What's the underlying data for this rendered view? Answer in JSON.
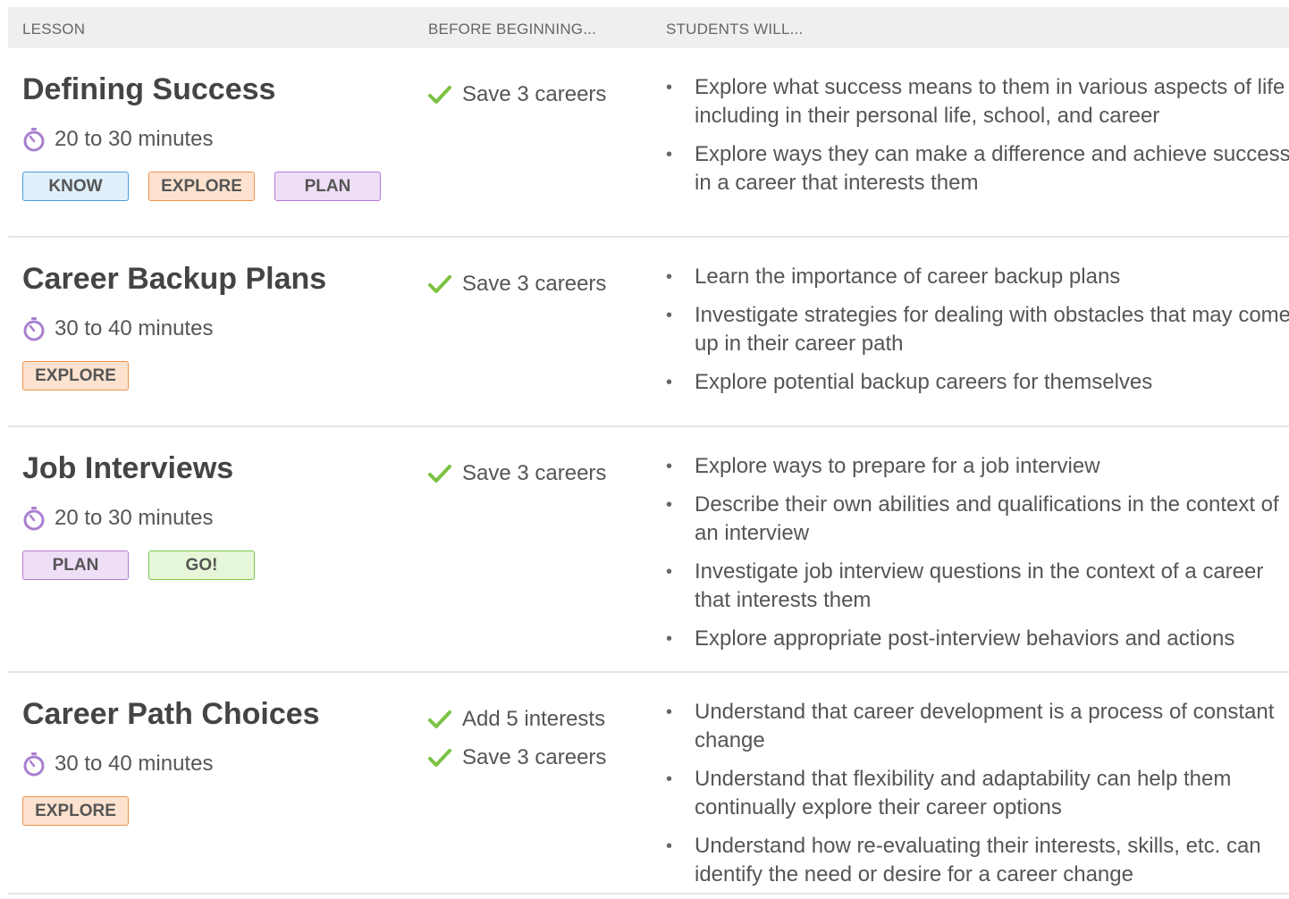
{
  "header": {
    "lesson": "LESSON",
    "before": "BEFORE BEGINNING...",
    "students": "STUDENTS WILL..."
  },
  "lessons": [
    {
      "title": "Defining Success",
      "duration": "20 to 30 minutes",
      "tags": [
        "KNOW",
        "EXPLORE",
        "PLAN"
      ],
      "prereqs": [
        "Save 3 careers"
      ],
      "outcomes": [
        "Explore what success means to them in various aspects of life including in their personal life, school, and career",
        "Explore ways they can make a difference and achieve success in a career that interests them"
      ]
    },
    {
      "title": "Career Backup Plans",
      "duration": "30 to 40 minutes",
      "tags": [
        "EXPLORE"
      ],
      "prereqs": [
        "Save 3 careers"
      ],
      "outcomes": [
        "Learn the importance of career backup plans",
        "Investigate strategies for dealing with obstacles that may come up in their career path",
        "Explore potential backup careers for themselves"
      ]
    },
    {
      "title": "Job Interviews",
      "duration": "20 to 30 minutes",
      "tags": [
        "PLAN",
        "GO!"
      ],
      "prereqs": [
        "Save 3 careers"
      ],
      "outcomes": [
        "Explore ways to prepare for a job interview",
        "Describe their own abilities and qualifications in the context of an interview",
        "Investigate job interview questions in the context of a career that interests them",
        "Explore appropriate post-interview behaviors and actions"
      ]
    },
    {
      "title": "Career Path Choices",
      "duration": "30 to 40 minutes",
      "tags": [
        "EXPLORE"
      ],
      "prereqs": [
        "Add 5 interests",
        "Save 3 careers"
      ],
      "outcomes": [
        "Understand that career development is a process of constant change",
        "Understand that flexibility and adaptability can help them continually explore their career options",
        "Understand how re-evaluating their interests, skills, etc. can identify the need or desire for a career change"
      ]
    }
  ],
  "colors": {
    "check": "#7cc242",
    "timer": "#a97fd0"
  }
}
